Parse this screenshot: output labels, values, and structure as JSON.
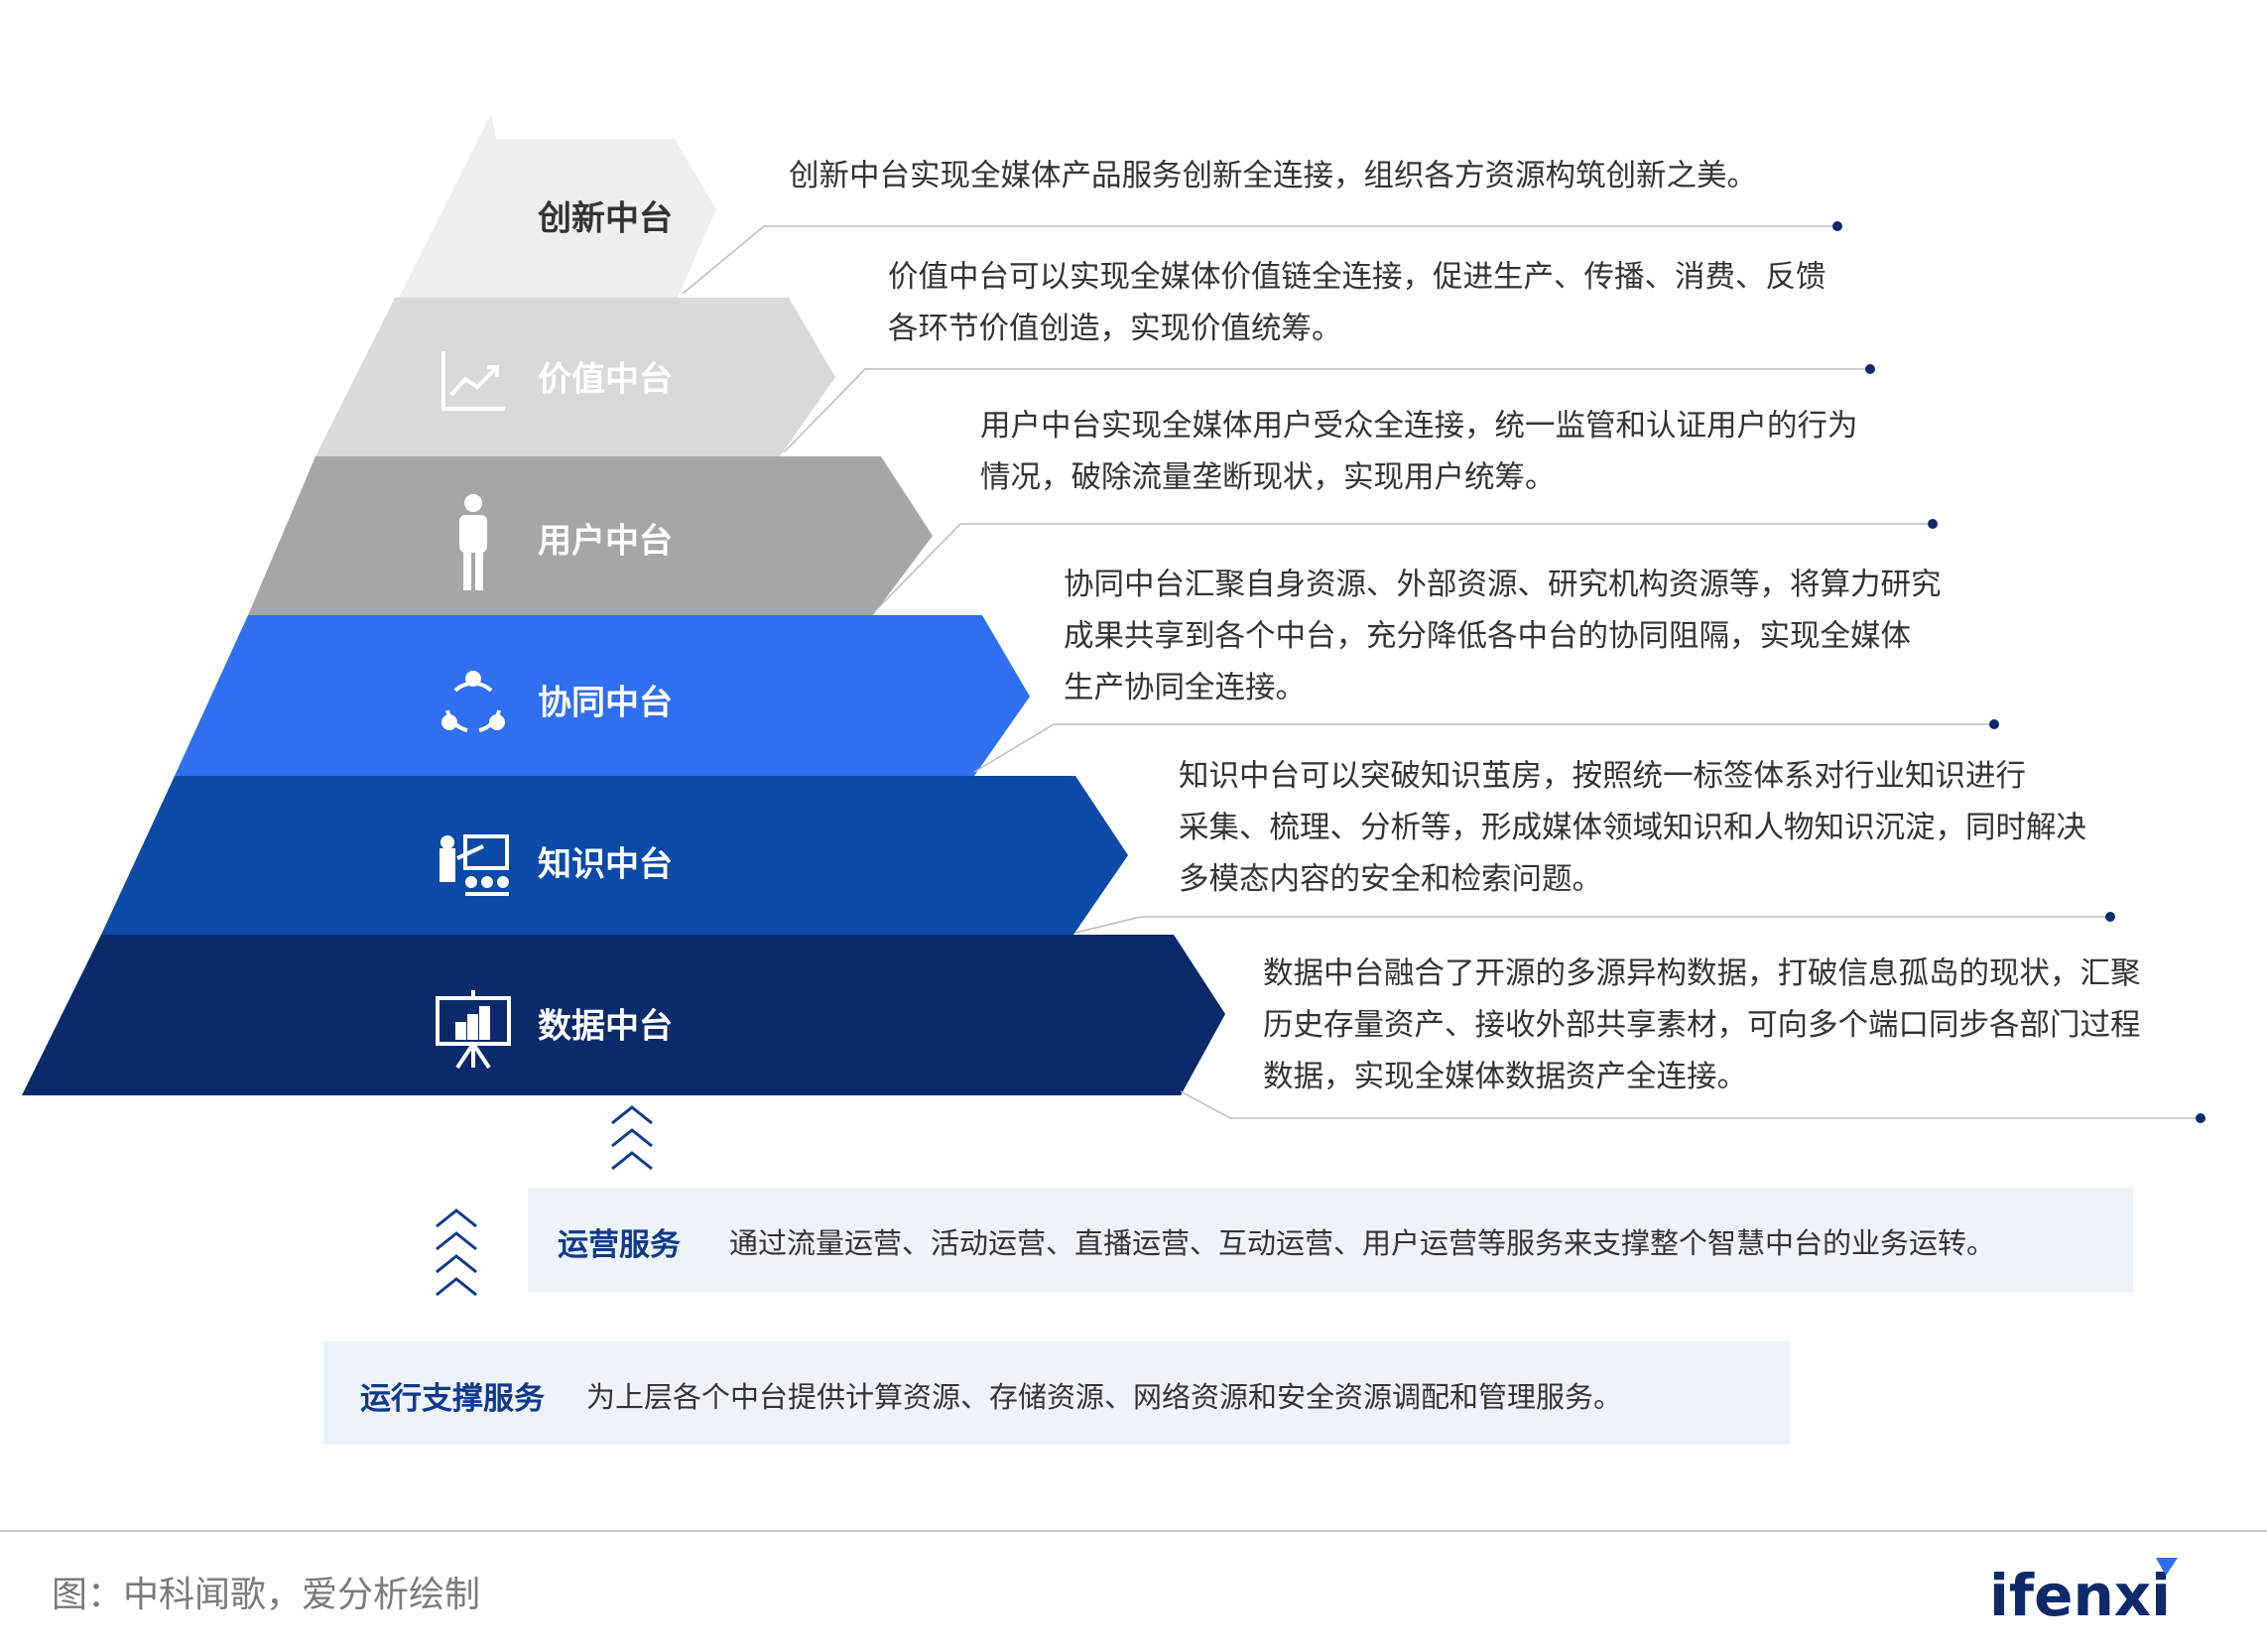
{
  "layers": [
    {
      "label": "创新中台",
      "icon": "none",
      "color": "#eeeeee",
      "text_color": "#333333",
      "description": [
        "创新中台实现全媒体产品服务创新全连接，组织各方资源构筑创新之美。"
      ]
    },
    {
      "label": "价值中台",
      "icon": "trend-chart-icon",
      "color": "#d9d9d9",
      "text_color": "#ffffff",
      "description": [
        "价值中台可以实现全媒体价值链全连接，促进生产、传播、消费、反馈",
        "各环节价值创造，实现价值统筹。"
      ]
    },
    {
      "label": "用户中台",
      "icon": "person-icon",
      "color": "#a6a6a6",
      "text_color": "#ffffff",
      "description": [
        "用户中台实现全媒体用户受众全连接，统一监管和认证用户的行为",
        "情况，破除流量垄断现状，实现用户统筹。"
      ]
    },
    {
      "label": "协同中台",
      "icon": "share-nodes-icon",
      "color": "#2f6ff0",
      "text_color": "#ffffff",
      "description": [
        "协同中台汇聚自身资源、外部资源、研究机构资源等，将算力研究",
        "成果共享到各个中台，充分降低各中台的协同阻隔，实现全媒体",
        "生产协同全连接。"
      ]
    },
    {
      "label": "知识中台",
      "icon": "teacher-board-icon",
      "color": "#0b4aa6",
      "text_color": "#ffffff",
      "description": [
        "知识中台可以突破知识茧房，按照统一标签体系对行业知识进行",
        "采集、梳理、分析等，形成媒体领域知识和人物知识沉淀，同时解决",
        "多模态内容的安全和检索问题。"
      ]
    },
    {
      "label": "数据中台",
      "icon": "presentation-chart-icon",
      "color": "#0a2a6b",
      "text_color": "#ffffff",
      "description": [
        "数据中台融合了开源的多源异构数据，打破信息孤岛的现状，汇聚",
        "历史存量资产、接收外部共享素材，可向多个端口同步各部门过程",
        "数据，实现全媒体数据资产全连接。"
      ]
    }
  ],
  "operations_service": {
    "title": "运营服务",
    "text": "通过流量运营、活动运营、直播运营、互动运营、用户运营等服务来支撑整个智慧中台的业务运转。"
  },
  "runtime_service": {
    "title": "运行支撑服务",
    "text": "为上层各个中台提供计算资源、存储资源、网络资源和安全资源调配和管理服务。"
  },
  "source": "图：中科闻歌，爱分析绘制",
  "logo": "ifenxi",
  "colors": {
    "accent": "#0e3a8a",
    "box_bg": "#eef3fb",
    "leader_line": "#bcbcbc",
    "dot": "#0e2a6b"
  }
}
